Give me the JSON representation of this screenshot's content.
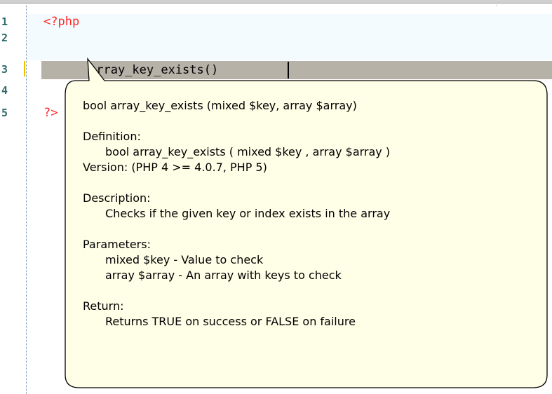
{
  "editor": {
    "line_numbers": [
      "1",
      "2",
      "3",
      "4",
      "5"
    ],
    "lines": {
      "line1": "<?php",
      "line3": "array_key_exists()",
      "line5": "?>"
    }
  },
  "tooltip": {
    "signature": "bool array_key_exists (mixed $key, array $array)",
    "definition_label": "Definition:",
    "definition_value": "bool array_key_exists ( mixed $key , array $array )",
    "version": "Version: (PHP 4 >= 4.0.7, PHP 5)",
    "description_label": "Description:",
    "description_value": "Checks if the given key or index exists in the array",
    "parameters_label": "Parameters:",
    "parameters": [
      "mixed $key - Value to check",
      "array $array - An array with keys to check"
    ],
    "return_label": "Return:",
    "return_value": "Returns TRUE on success or FALSE on failure"
  },
  "colors": {
    "php_tag": "#ff2a2a",
    "tooltip_bg": "#ffffe8",
    "selected_line_bg": "#b6b2a8",
    "line_number": "#2f6a6a"
  }
}
